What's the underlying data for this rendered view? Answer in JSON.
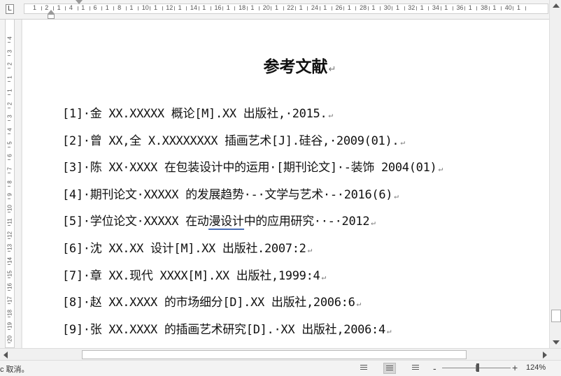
{
  "ruler": {
    "corner_label": "L",
    "top_numbers": [
      "1",
      "2",
      "1",
      "4",
      "1",
      "6",
      "1",
      "8",
      "1",
      "10",
      "1",
      "12",
      "1",
      "14",
      "1",
      "16",
      "1",
      "18",
      "1",
      "20",
      "1",
      "22",
      "1",
      "24",
      "1",
      "26",
      "1",
      "28",
      "1",
      "30",
      "1",
      "32",
      "1",
      "34",
      "1",
      "36",
      "1",
      "38",
      "1",
      "40",
      "1"
    ],
    "left_numbers": [
      "4",
      "3",
      "2",
      "1",
      "1",
      "2",
      "3",
      "4",
      "5",
      "6",
      "7",
      "8",
      "9",
      "10",
      "11",
      "12",
      "13",
      "14",
      "15",
      "16",
      "17",
      "18",
      "19",
      "20",
      "21"
    ]
  },
  "document": {
    "title": "参考文献",
    "pilcrow": "↵",
    "references": [
      {
        "text": "[1]·金 XX.XXXXX 概论[M].XX 出版社,·2015."
      },
      {
        "text": "[2]·曾 XX,全 X.XXXXXXXX 插画艺术[J].硅谷,·2009(01)."
      },
      {
        "text": "[3]·陈 XX·XXXX 在包装设计中的运用·[期刊论文]·-装饰 2004(01)"
      },
      {
        "text": "[4]·期刊论文·XXXXX 的发展趋势·-·文学与艺术·-·2016(6)"
      },
      {
        "pre": "[5]·学位论文·XXXXX 在动",
        "squiggle": "漫设计",
        "post": "中的应用研究··-·2012"
      },
      {
        "text": "[6]·沈 XX.XX 设计[M].XX 出版社.2007:2"
      },
      {
        "text": "[7]·章 XX.现代 XXXX[M].XX 出版社,1999:4"
      },
      {
        "text": "[8]·赵 XX.XXXX 的市场细分[D].XX 出版社,2006:6"
      },
      {
        "text": "[9]·张 XX.XXXX 的插画艺术研究[D].·XX 出版社,2006:4"
      }
    ]
  },
  "status_bar": {
    "message": "c 取消。",
    "zoom_minus": "-",
    "zoom_plus": "+",
    "zoom_level": "124%"
  }
}
